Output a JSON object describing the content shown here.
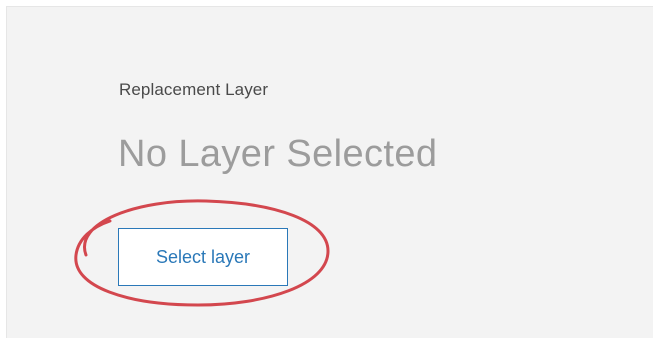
{
  "replacement_layer": {
    "label": "Replacement Layer",
    "status": "No Layer Selected",
    "select_button_label": "Select layer"
  },
  "colors": {
    "panel_background": "#f3f3f3",
    "accent": "#2a78b8",
    "status_text": "#9c9c9c",
    "label_text": "#4a4a4a",
    "highlight_annotation": "#d3474e"
  }
}
